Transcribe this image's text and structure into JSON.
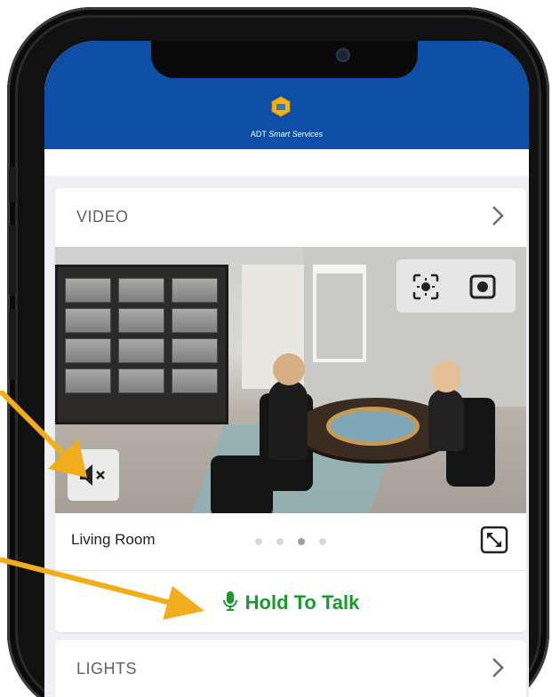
{
  "header": {
    "brand_name": "ADT",
    "brand_suffix": "Smart Services",
    "bg_color": "#0d4ea6"
  },
  "video_card": {
    "title": "VIDEO",
    "chevron_icon": "chevron-right-icon",
    "camera_controls": [
      "focus-icon",
      "record-icon"
    ],
    "mute_icon": "speaker-muted-icon",
    "room_name": "Living Room",
    "page_dots": {
      "count": 4,
      "active_index": 2
    },
    "expand_icon": "expand-icon",
    "talk_label": "Hold To Talk",
    "talk_color": "#1a9a2e"
  },
  "lights_card": {
    "title": "LIGHTS",
    "chevron_icon": "chevron-right-icon"
  },
  "annotation": {
    "arrow_color": "#f2ad1c"
  }
}
